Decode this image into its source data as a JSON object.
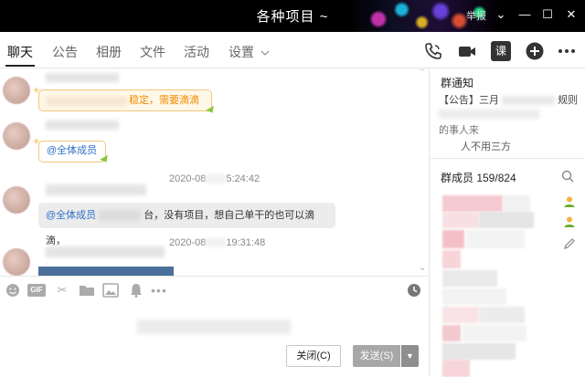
{
  "window": {
    "title": "各种项目 ~",
    "report_label": "举报",
    "controls": [
      "⌄",
      "—",
      "☐",
      "✕"
    ]
  },
  "tabs": [
    {
      "label": "聊天",
      "active": true
    },
    {
      "label": "公告"
    },
    {
      "label": "相册"
    },
    {
      "label": "文件"
    },
    {
      "label": "活动"
    },
    {
      "label": "设置"
    }
  ],
  "toolbar_icons": [
    "phone-icon",
    "video-call-icon",
    "course-icon",
    "add-icon",
    "more-icon"
  ],
  "toolbar_course_label": "课",
  "messages": {
    "msg1_text": "稳定，需要滴滴",
    "msg2_mention": "@全体成员",
    "time1": "2020-08",
    "time1_b": "5:24:42",
    "msg3_mention": "@全体成员",
    "msg3_text": "台，没有项目，想自己单干的也可以滴滴，",
    "time2": "2020-08",
    "time2_b": "19:31:48"
  },
  "input_tools": [
    "emoji-icon",
    "gif-icon",
    "scissors-icon",
    "folder-icon",
    "image-icon",
    "bell-icon",
    "more-icon",
    "history-icon"
  ],
  "input_gif_label": "GIF",
  "buttons": {
    "close_label": "关闭(C)",
    "send_label": "发送(S)"
  },
  "sidebar": {
    "notice_title": "群通知",
    "notice_line1": "【公告】三月",
    "notice_line1_b": "规则",
    "notice_line3": "的事人来",
    "notice_line4": "人不用三方",
    "members_label": "群成员 159/824"
  }
}
